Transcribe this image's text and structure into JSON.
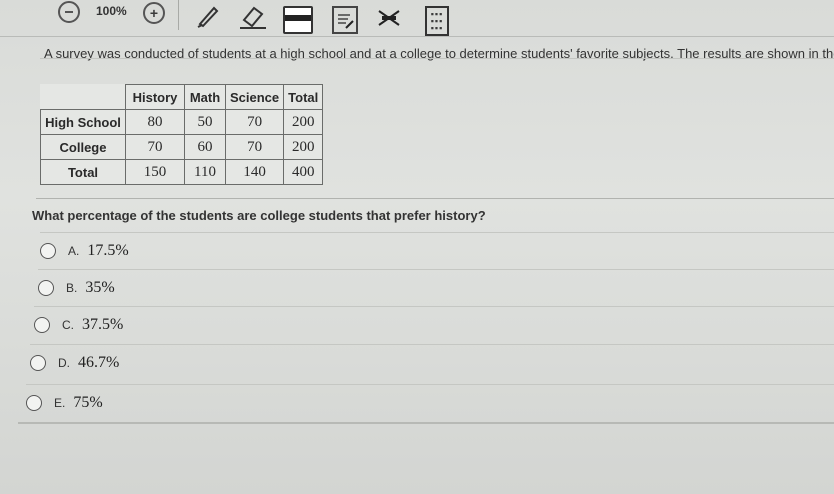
{
  "toolbar": {
    "zoom_level": "100%",
    "icons": [
      "zoom-out-icon",
      "zoom-in-icon",
      "pen-icon",
      "eraser-icon",
      "highlighter-icon",
      "reference-icon",
      "eliminate-icon",
      "calculator-icon"
    ]
  },
  "question": {
    "stem": "A survey was conducted of students at a high school and at a college to determine students' favorite subjects. The results are shown in the table",
    "prompt": "What percentage of the students are college students that prefer history?"
  },
  "table": {
    "headers": [
      "",
      "History",
      "Math",
      "Science",
      "Total"
    ],
    "rows": [
      [
        "High School",
        "80",
        "50",
        "70",
        "200"
      ],
      [
        "College",
        "70",
        "60",
        "70",
        "200"
      ],
      [
        "Total",
        "150",
        "110",
        "140",
        "400"
      ]
    ]
  },
  "choices": [
    {
      "letter": "A.",
      "value": "17.5%"
    },
    {
      "letter": "B.",
      "value": "35%"
    },
    {
      "letter": "C.",
      "value": "37.5%"
    },
    {
      "letter": "D.",
      "value": "46.7%"
    },
    {
      "letter": "E.",
      "value": "75%"
    }
  ]
}
